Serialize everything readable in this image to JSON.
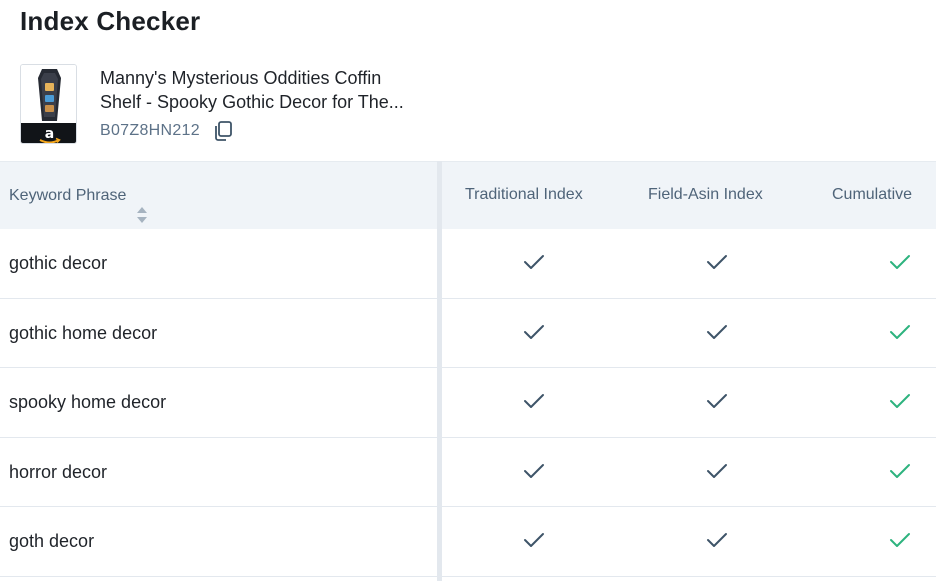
{
  "page": {
    "title": "Index Checker"
  },
  "product": {
    "title_line1": "Manny's Mysterious Oddities Coffin",
    "title_line2": "Shelf - Spooky Gothic Decor for The...",
    "asin": "B07Z8HN212",
    "thumbnail_icon": "amazon-logo-icon",
    "copy_icon": "copy-icon"
  },
  "table": {
    "headers": {
      "keyword": "Keyword Phrase",
      "traditional": "Traditional Index",
      "field_asin": "Field-Asin Index",
      "cumulative": "Cumulative"
    },
    "rows": [
      {
        "keyword": "gothic decor",
        "traditional": true,
        "field_asin": true,
        "cumulative": true
      },
      {
        "keyword": "gothic home decor",
        "traditional": true,
        "field_asin": true,
        "cumulative": true
      },
      {
        "keyword": "spooky home decor",
        "traditional": true,
        "field_asin": true,
        "cumulative": true
      },
      {
        "keyword": "horror decor",
        "traditional": true,
        "field_asin": true,
        "cumulative": true
      },
      {
        "keyword": "goth decor",
        "traditional": true,
        "field_asin": true,
        "cumulative": true
      }
    ]
  },
  "colors": {
    "check_dark": "#3e5468",
    "check_green": "#2db37e",
    "header_bg": "#f0f4f8",
    "muted_text": "#5d7288"
  }
}
